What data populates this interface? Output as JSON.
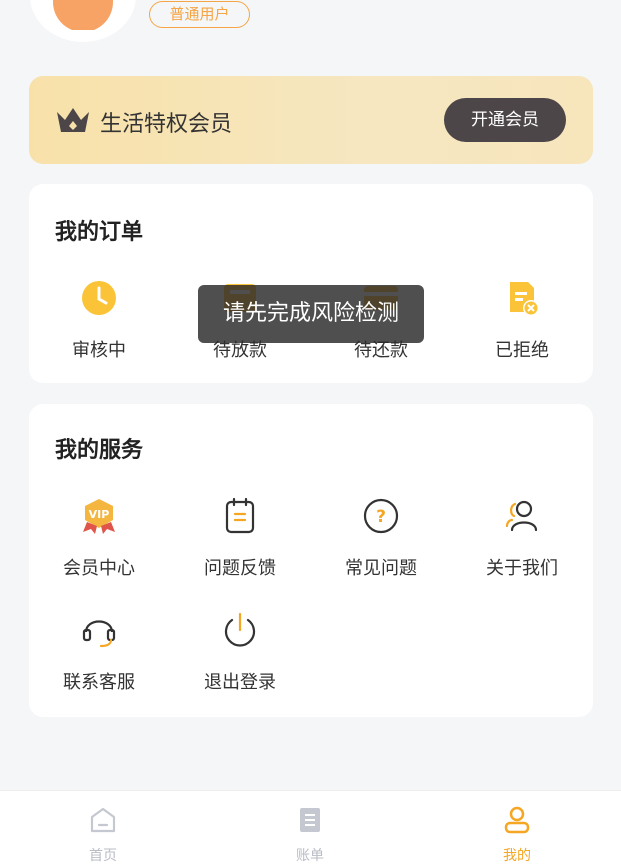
{
  "profile": {
    "user_type": "普通用户"
  },
  "vip": {
    "title": "生活特权会员",
    "open_button": "开通会员",
    "icon": "crown-icon"
  },
  "orders": {
    "title": "我的订单",
    "items": [
      {
        "label": "审核中",
        "icon": "clock-icon"
      },
      {
        "label": "待放款",
        "icon": "wallet-icon"
      },
      {
        "label": "待还款",
        "icon": "card-icon"
      },
      {
        "label": "已拒绝",
        "icon": "document-rejected-icon"
      }
    ]
  },
  "services": {
    "title": "我的服务",
    "items": [
      {
        "label": "会员中心",
        "icon": "vip-badge-icon"
      },
      {
        "label": "问题反馈",
        "icon": "clipboard-icon"
      },
      {
        "label": "常见问题",
        "icon": "question-icon"
      },
      {
        "label": "关于我们",
        "icon": "users-icon"
      },
      {
        "label": "联系客服",
        "icon": "headset-icon"
      },
      {
        "label": "退出登录",
        "icon": "power-icon"
      }
    ]
  },
  "toast": {
    "message": "请先完成风险检测"
  },
  "tabbar": {
    "items": [
      {
        "label": "首页",
        "icon": "home-icon",
        "active": false
      },
      {
        "label": "账单",
        "icon": "bill-icon",
        "active": false
      },
      {
        "label": "我的",
        "icon": "user-icon",
        "active": true
      }
    ]
  },
  "colors": {
    "accent": "#f5a623",
    "vip_button": "#4c4649",
    "background": "#f5f6f8",
    "tab_inactive": "#b9bcc6"
  }
}
